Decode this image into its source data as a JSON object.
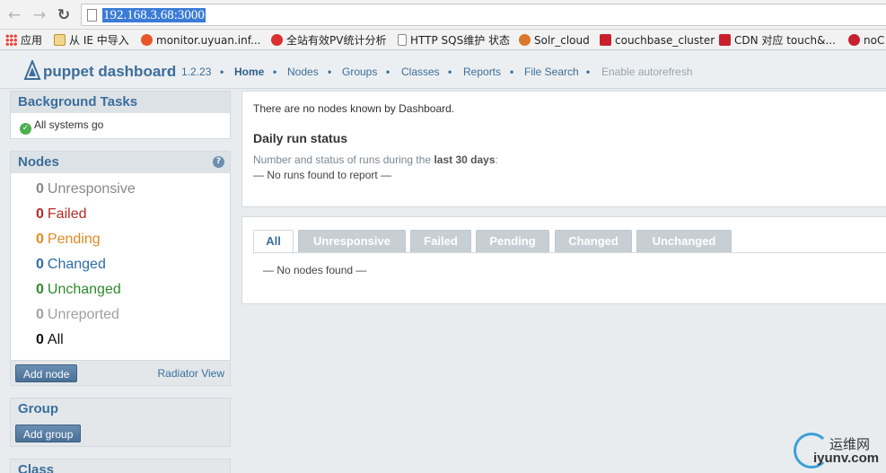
{
  "browser": {
    "url": "192.168.3.68:3000",
    "bookmarks": [
      {
        "label": "应用",
        "icon": "apps-grid-icon",
        "color": "#e8453c"
      },
      {
        "label": "从 IE 中导入",
        "icon": "folder-icon",
        "color": "#e9c46a"
      },
      {
        "label": "monitor.uyuan.inf...",
        "icon": "heart-icon",
        "color": "#e8552c"
      },
      {
        "label": "全站有效PV统计分析",
        "icon": "heart-icon",
        "color": "#d93030"
      },
      {
        "label": "HTTP SQS维护 状态",
        "icon": "page-icon",
        "color": "#ffffff"
      },
      {
        "label": "Solr_cloud",
        "icon": "solr-icon",
        "color": "#d9772b"
      },
      {
        "label": "couchbase_cluster",
        "icon": "couchbase-icon",
        "color": "#c8202f"
      },
      {
        "label": "CDN 对应 touch&...",
        "icon": "couchbase-icon",
        "color": "#c8202f"
      },
      {
        "label": "noC",
        "icon": "incognito-icon",
        "color": "#c8202f"
      }
    ]
  },
  "header": {
    "brand": "puppet dashboard",
    "version": "1.2.23",
    "sep": "•",
    "nav": [
      "Home",
      "Nodes",
      "Groups",
      "Classes",
      "Reports",
      "File Search"
    ],
    "autorefresh": "Enable autorefresh"
  },
  "sidebar": {
    "background_tasks": {
      "title": "Background Tasks",
      "status": "All systems go"
    },
    "nodes": {
      "title": "Nodes",
      "statuses": [
        {
          "count": "0",
          "label": "Unresponsive",
          "color": "#888888"
        },
        {
          "count": "0",
          "label": "Failed",
          "color": "#b52b27"
        },
        {
          "count": "0",
          "label": "Pending",
          "color": "#e08a24"
        },
        {
          "count": "0",
          "label": "Changed",
          "color": "#2e6da4"
        },
        {
          "count": "0",
          "label": "Unchanged",
          "color": "#2e8b2e"
        },
        {
          "count": "0",
          "label": "Unreported",
          "color": "#a0a0a0"
        },
        {
          "count": "0",
          "label": "All",
          "color": "#111111"
        }
      ],
      "add_button": "Add node",
      "radiator_link": "Radiator View"
    },
    "group": {
      "title": "Group",
      "add_button": "Add group"
    },
    "class": {
      "title": "Class"
    }
  },
  "main": {
    "no_nodes_msg": "There are no nodes known by Dashboard.",
    "daily_title": "Daily run status",
    "daily_desc_prefix": "Number and status of runs during the ",
    "daily_desc_bold": "last 30 days",
    "daily_desc_suffix": ":",
    "no_runs": "— No runs found to report —",
    "tabs": [
      "All",
      "Unresponsive",
      "Failed",
      "Pending",
      "Changed",
      "Unchanged"
    ],
    "no_nodes_found": "— No nodes found —"
  },
  "watermark": {
    "line1": "运维网",
    "line2": "iyunv.com"
  }
}
